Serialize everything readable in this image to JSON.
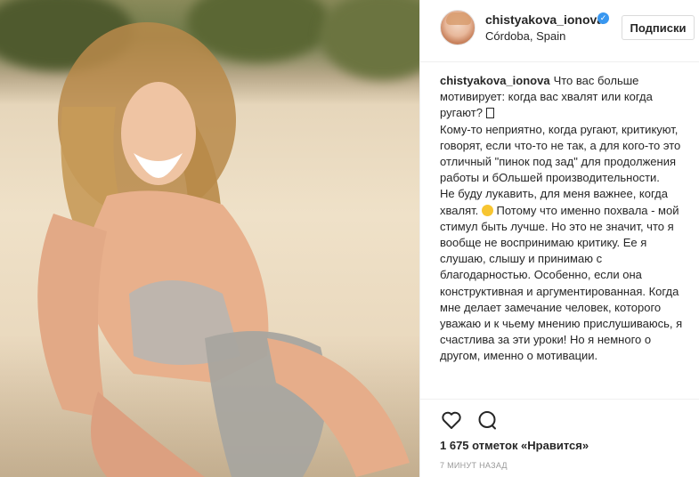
{
  "post": {
    "username": "chistyakova_ionova",
    "location": "Córdoba, Spain",
    "follow_label": "Подписки",
    "caption_user": "chistyakova_ionova",
    "caption_lines": [
      "Что вас больше мотивирует: когда вас хвалят или когда ругают?",
      "Кому-то неприятно, когда ругают, критикуют, говорят, если что-то не так, а для кого-то это отличный \"пинок под зад\" для продолжения работы и бОльшей производительности.",
      "Не буду лукавить, для меня важнее, когда хвалят.",
      "Потому что именно похвала - мой стимул быть лучше. Но это не значит, что я вообще не воспринимаю критику. Ее я слушаю, слышу и принимаю с благодарностью. Особенно, если она конструктивная и аргументированная. Когда мне делает замечание человек, которого уважаю и к чьему мнению прислушиваюсь, я счастлива за эти уроки! Но я немного о другом, именно о мотивации."
    ],
    "likes_text": "1 675 отметок «Нравится»",
    "time_text": "7 МИНУТ НАЗАД"
  },
  "icons": {
    "verified": "verified-badge-icon",
    "like": "heart-icon",
    "comment": "comment-icon"
  },
  "colors": {
    "verified_blue": "#3897f0",
    "text": "#262626",
    "muted": "#999999",
    "border": "#dbdbdb"
  }
}
